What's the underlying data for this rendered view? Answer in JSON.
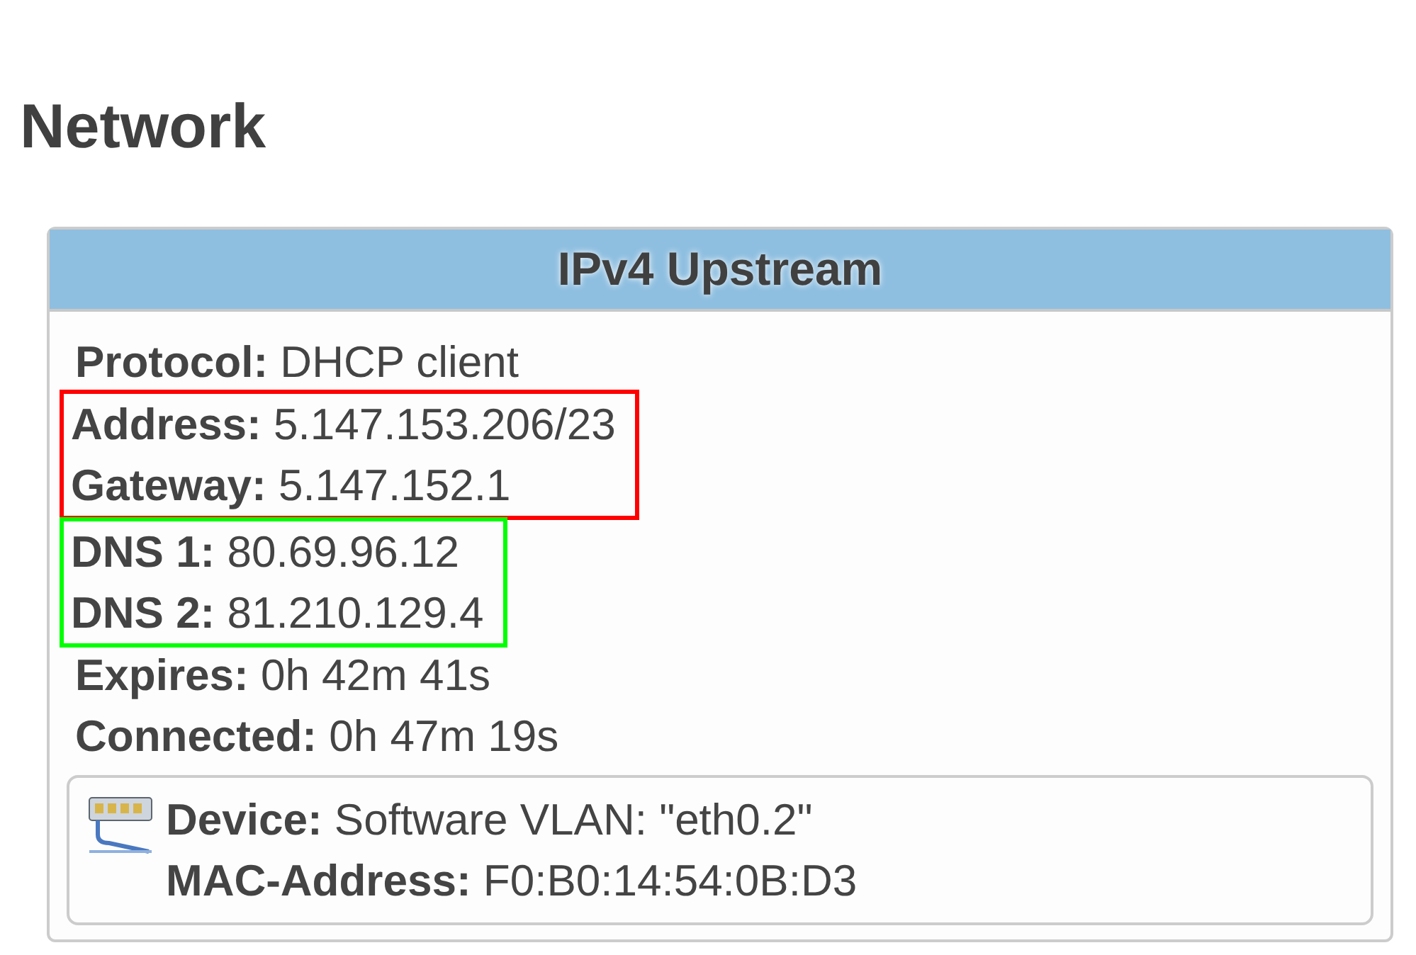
{
  "page_title": "Network",
  "card": {
    "title": "IPv4 Upstream",
    "groups": [
      {
        "lines": [
          "**Protocol:** DHCP client"
        ]
      },
      {
        "color": "#ff0000",
        "lines": [
          "**Address:** 5.147.153.206/23",
          "**Gateway:** 5.147.152.1"
        ]
      },
      {
        "color": "#00ff00",
        "lines": [
          "**DNS 1:** 80.69.96.12",
          "**DNS 2:** 81.210.129.4"
        ]
      },
      {
        "lines": [
          "**Expires:** 0h 42m 41s",
          "**Connected:** 0h 47m 19s"
        ]
      }
    ],
    "device": {
      "lines": [
        "**Device:** Software VLAN: \"eth0.2\"",
        "**MAC-Address:** F0:B0:14:54:0B:D3"
      ]
    }
  }
}
